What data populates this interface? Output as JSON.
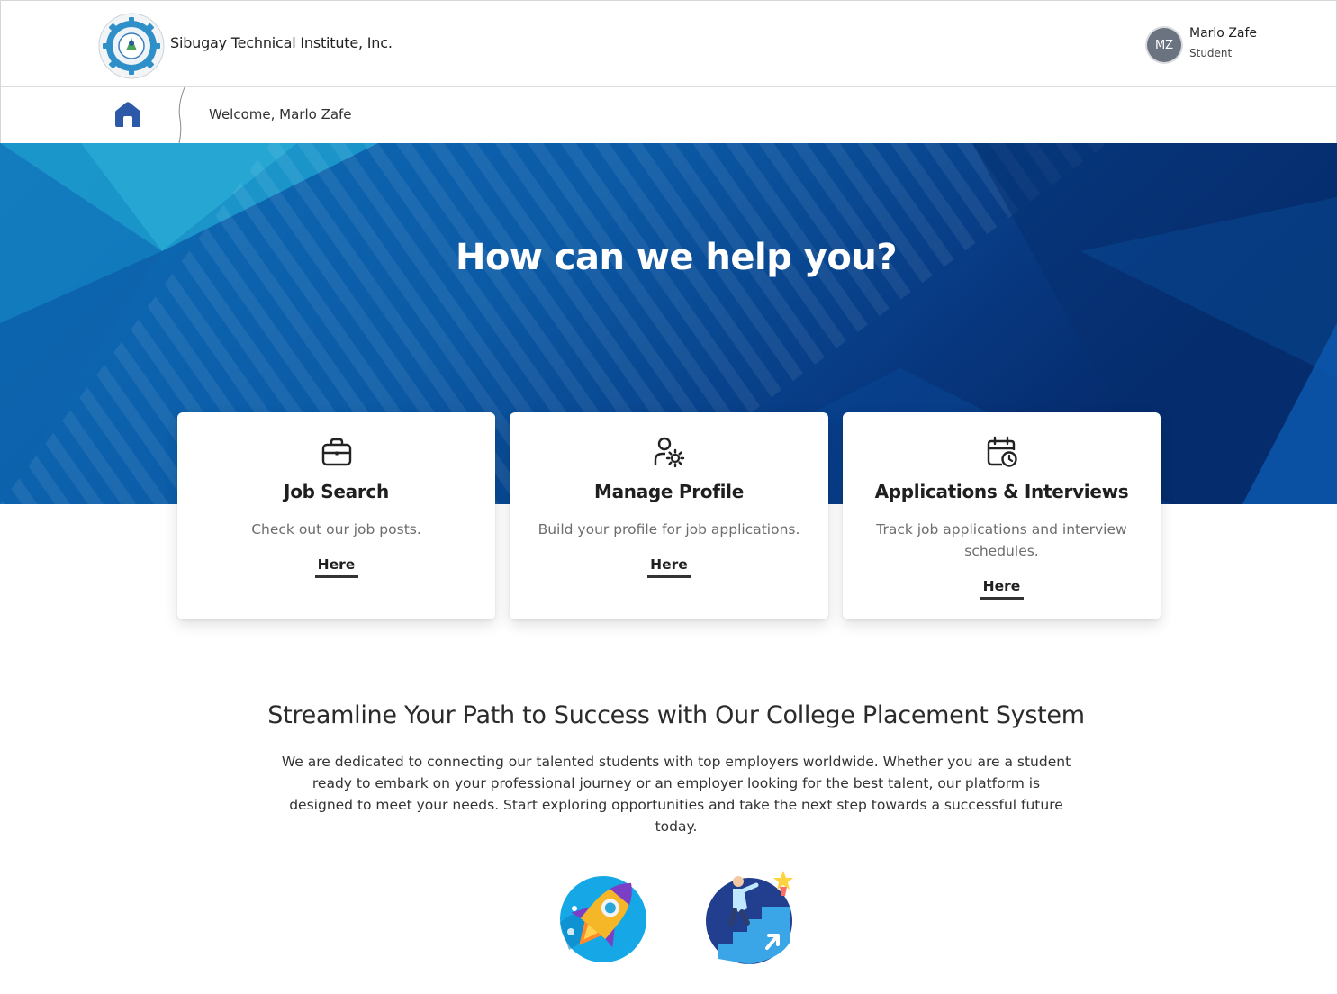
{
  "header": {
    "brand_name": "Sibugay Technical Institute, Inc.",
    "user": {
      "initials": "MZ",
      "name": "Marlo Zafe",
      "role": "Student"
    }
  },
  "breadcrumb": {
    "welcome_text": "Welcome, Marlo Zafe"
  },
  "hero": {
    "title": "How can we help you?"
  },
  "cards": [
    {
      "icon": "briefcase-icon",
      "title": "Job Search",
      "description": "Check out our job posts.",
      "link": "Here"
    },
    {
      "icon": "user-gear-icon",
      "title": "Manage Profile",
      "description": "Build your profile for job applications.",
      "link": "Here"
    },
    {
      "icon": "calendar-clock-icon",
      "title": "Applications & Interviews",
      "description": "Track job applications and interview schedules.",
      "link": "Here"
    }
  ],
  "section": {
    "title": "Streamline Your Path to Success with Our College Placement System",
    "text": "We are dedicated to connecting our talented students with top employers worldwide. Whether you are a student ready to embark on your professional journey or an employer looking for the best talent, our platform is designed to meet your needs. Start exploring opportunities and take the next step towards a successful future today."
  },
  "illustrations": [
    "rocket-illustration",
    "stairs-success-illustration"
  ],
  "colors": {
    "hero_dark": "#0a3f86",
    "hero_light": "#1a8cc4",
    "home_icon": "#2d5aa8"
  }
}
